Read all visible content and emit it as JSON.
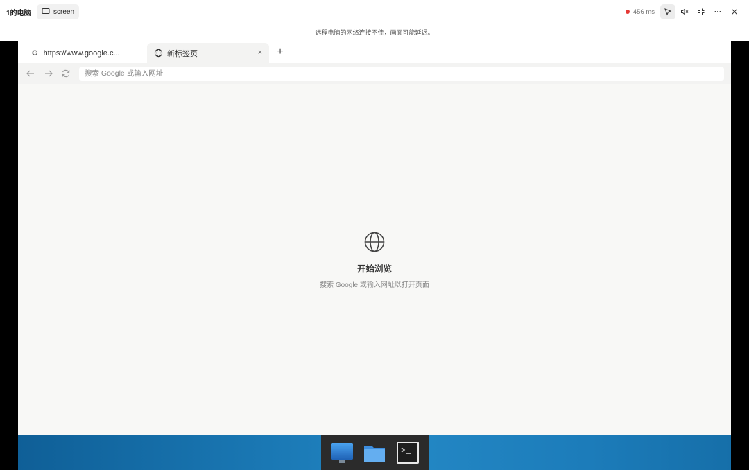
{
  "topbar": {
    "computer_name": "1的电脑",
    "screen_label": "screen",
    "latency": "456 ms",
    "latency_color": "#e53935"
  },
  "notice": "远程电脑的网络连接不佳，画面可能延迟。",
  "browser": {
    "tabs": [
      {
        "label": "https://www.google.c...",
        "icon": "google-icon",
        "icon_text": "G"
      },
      {
        "label": "新标签页",
        "icon": "globe-icon",
        "close": "×"
      }
    ],
    "new_tab": "+",
    "address_placeholder": "搜索 Google 或输入网址"
  },
  "page": {
    "heading": "开始浏览",
    "subtitle": "搜索 Google 或输入网址以打开页面"
  },
  "taskbar": {
    "items": [
      "computer-icon",
      "folder-icon",
      "terminal-icon"
    ]
  },
  "colors": {
    "taskbar": "#1a78b4",
    "dock": "#2b2b2b",
    "page_bg": "#f8f8f6"
  }
}
